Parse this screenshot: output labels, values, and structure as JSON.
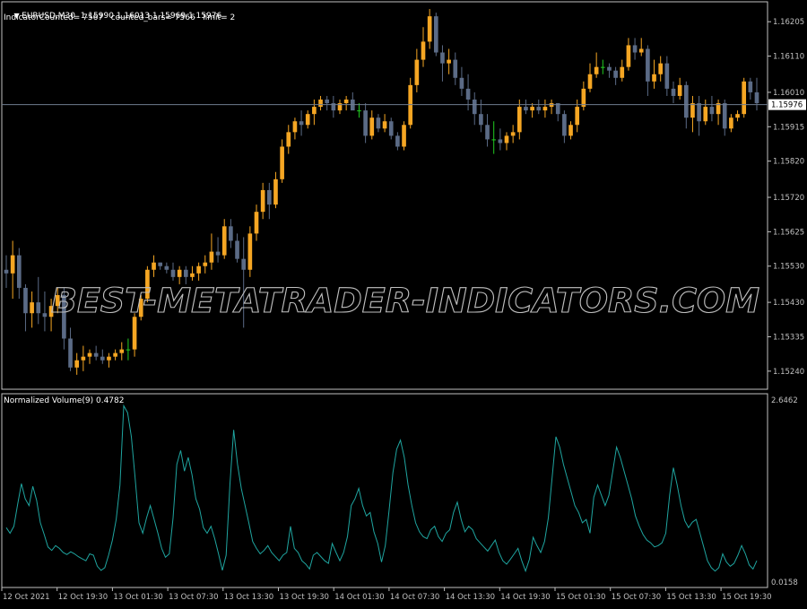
{
  "header": {
    "symbol_line": "EURUSD,M30  1.15990 1.16013 1.15969 1.15976",
    "counter_line": "IndicatorCounted= 7567   counted_bars= 7566   limit= 2"
  },
  "indicator": {
    "label": "Normalized Volume(9) 0.4782",
    "max_label": "2.6462",
    "min_label": "0.0158"
  },
  "watermark": "BEST-METATRADER-INDICATORS.COM",
  "colors": {
    "background": "#000000",
    "bull": "#f5a623",
    "bear": "#5b6b86",
    "doji": "#22cc22",
    "axis": "#c0c0c0",
    "price_line": "#6e7b8f",
    "volume": "#1fa5a0",
    "current_price_box": "#ffffff"
  },
  "chart_data": [
    {
      "type": "candlestick",
      "title": "EURUSD,M30",
      "current_price": 1.15976,
      "ylim": [
        1.1519,
        1.1626
      ],
      "y_ticks": [
        "1.16205",
        "1.16110",
        "1.16010",
        "1.15915",
        "1.15820",
        "1.15720",
        "1.15625",
        "1.15530",
        "1.15430",
        "1.15335",
        "1.15240"
      ],
      "x_ticks": [
        "12 Oct 2021",
        "12 Oct 19:30",
        "13 Oct 01:30",
        "13 Oct 07:30",
        "13 Oct 13:30",
        "13 Oct 19:30",
        "14 Oct 01:30",
        "14 Oct 07:30",
        "14 Oct 13:30",
        "14 Oct 19:30",
        "15 Oct 01:30",
        "15 Oct 07:30",
        "15 Oct 13:30",
        "15 Oct 19:30"
      ],
      "candles_ohlc": [
        [
          1.1552,
          1.1556,
          1.1547,
          1.1551
        ],
        [
          1.1551,
          1.156,
          1.1544,
          1.1556
        ],
        [
          1.1556,
          1.1558,
          1.1544,
          1.1547
        ],
        [
          1.1547,
          1.1548,
          1.1535,
          1.154
        ],
        [
          1.154,
          1.1546,
          1.1536,
          1.1543
        ],
        [
          1.1543,
          1.155,
          1.1537,
          1.154
        ],
        [
          1.154,
          1.1546,
          1.1535,
          1.1539
        ],
        [
          1.1539,
          1.1544,
          1.1535,
          1.1542
        ],
        [
          1.1542,
          1.1547,
          1.154,
          1.1545
        ],
        [
          1.1545,
          1.1547,
          1.153,
          1.1533
        ],
        [
          1.1533,
          1.1536,
          1.1524,
          1.1525
        ],
        [
          1.1525,
          1.1529,
          1.1523,
          1.1527
        ],
        [
          1.1527,
          1.1531,
          1.1524,
          1.1528
        ],
        [
          1.1528,
          1.153,
          1.1526,
          1.1529
        ],
        [
          1.1529,
          1.1531,
          1.1527,
          1.1528
        ],
        [
          1.1528,
          1.153,
          1.1526,
          1.1527
        ],
        [
          1.1527,
          1.1529,
          1.1525,
          1.1528
        ],
        [
          1.1528,
          1.153,
          1.1527,
          1.1529
        ],
        [
          1.1529,
          1.1532,
          1.1527,
          1.153
        ],
        [
          1.153,
          1.1533,
          1.1527,
          1.153
        ],
        [
          1.153,
          1.154,
          1.1528,
          1.1539
        ],
        [
          1.1539,
          1.1545,
          1.1538,
          1.1544
        ],
        [
          1.1544,
          1.1553,
          1.1543,
          1.1552
        ],
        [
          1.1552,
          1.1556,
          1.155,
          1.1554
        ],
        [
          1.1554,
          1.1554,
          1.1552,
          1.1553
        ],
        [
          1.1553,
          1.1554,
          1.1551,
          1.1552
        ],
        [
          1.1552,
          1.1554,
          1.1549,
          1.155
        ],
        [
          1.155,
          1.1553,
          1.1548,
          1.1552
        ],
        [
          1.1552,
          1.1553,
          1.1548,
          1.155
        ],
        [
          1.155,
          1.1553,
          1.1549,
          1.1551
        ],
        [
          1.1551,
          1.1554,
          1.1549,
          1.1553
        ],
        [
          1.1553,
          1.1556,
          1.1551,
          1.1554
        ],
        [
          1.1554,
          1.1562,
          1.1552,
          1.1557
        ],
        [
          1.1557,
          1.1561,
          1.1554,
          1.1556
        ],
        [
          1.1556,
          1.1566,
          1.1555,
          1.1564
        ],
        [
          1.1564,
          1.1566,
          1.1558,
          1.156
        ],
        [
          1.156,
          1.1562,
          1.1554,
          1.1555
        ],
        [
          1.1555,
          1.1561,
          1.1536,
          1.1552
        ],
        [
          1.1552,
          1.1564,
          1.155,
          1.1562
        ],
        [
          1.1562,
          1.157,
          1.156,
          1.1568
        ],
        [
          1.1568,
          1.1576,
          1.1566,
          1.1574
        ],
        [
          1.1574,
          1.1576,
          1.1566,
          1.157
        ],
        [
          1.157,
          1.1579,
          1.1569,
          1.1577
        ],
        [
          1.1577,
          1.1588,
          1.1576,
          1.1586
        ],
        [
          1.1586,
          1.1592,
          1.1584,
          1.159
        ],
        [
          1.159,
          1.1594,
          1.1588,
          1.1593
        ],
        [
          1.1593,
          1.1596,
          1.1589,
          1.1592
        ],
        [
          1.1592,
          1.1596,
          1.1591,
          1.1595
        ],
        [
          1.1595,
          1.1599,
          1.1592,
          1.1597
        ],
        [
          1.1597,
          1.16,
          1.1596,
          1.1599
        ],
        [
          1.1599,
          1.16,
          1.1596,
          1.1598
        ],
        [
          1.1598,
          1.16,
          1.1594,
          1.1596
        ],
        [
          1.1596,
          1.1599,
          1.1595,
          1.1598
        ],
        [
          1.1598,
          1.16,
          1.1596,
          1.1599
        ],
        [
          1.1599,
          1.1601,
          1.1597,
          1.1596
        ],
        [
          1.1596,
          1.1598,
          1.1594,
          1.1596
        ],
        [
          1.1596,
          1.1598,
          1.1587,
          1.1589
        ],
        [
          1.1589,
          1.1596,
          1.1588,
          1.1594
        ],
        [
          1.1594,
          1.1595,
          1.159,
          1.1591
        ],
        [
          1.1591,
          1.1595,
          1.159,
          1.1593
        ],
        [
          1.1593,
          1.1594,
          1.1588,
          1.1589
        ],
        [
          1.1589,
          1.159,
          1.1585,
          1.1586
        ],
        [
          1.1586,
          1.1593,
          1.1585,
          1.1592
        ],
        [
          1.1592,
          1.1605,
          1.1591,
          1.1603
        ],
        [
          1.1603,
          1.1613,
          1.1601,
          1.161
        ],
        [
          1.161,
          1.1619,
          1.1608,
          1.1615
        ],
        [
          1.1615,
          1.1624,
          1.1613,
          1.1622
        ],
        [
          1.1622,
          1.1623,
          1.1611,
          1.1612
        ],
        [
          1.1612,
          1.1614,
          1.1604,
          1.1609
        ],
        [
          1.1609,
          1.1613,
          1.1606,
          1.161
        ],
        [
          1.161,
          1.1612,
          1.1603,
          1.1605
        ],
        [
          1.1605,
          1.1608,
          1.16,
          1.1602
        ],
        [
          1.1602,
          1.1606,
          1.1596,
          1.1599
        ],
        [
          1.1599,
          1.1601,
          1.1592,
          1.1595
        ],
        [
          1.1595,
          1.1599,
          1.159,
          1.1592
        ],
        [
          1.1592,
          1.1595,
          1.1586,
          1.1588
        ],
        [
          1.1588,
          1.1593,
          1.1584,
          1.1588
        ],
        [
          1.1588,
          1.1591,
          1.1585,
          1.1587
        ],
        [
          1.1587,
          1.159,
          1.1585,
          1.1589
        ],
        [
          1.1589,
          1.1592,
          1.1587,
          1.159
        ],
        [
          1.159,
          1.1599,
          1.1588,
          1.1597
        ],
        [
          1.1597,
          1.1599,
          1.1595,
          1.1596
        ],
        [
          1.1596,
          1.1598,
          1.1594,
          1.1597
        ],
        [
          1.1597,
          1.1599,
          1.1595,
          1.1596
        ],
        [
          1.1596,
          1.1599,
          1.1594,
          1.1597
        ],
        [
          1.1597,
          1.1599,
          1.1595,
          1.1598
        ],
        [
          1.1598,
          1.1598,
          1.1593,
          1.1595
        ],
        [
          1.1595,
          1.1596,
          1.1587,
          1.1589
        ],
        [
          1.1589,
          1.1593,
          1.1588,
          1.1592
        ],
        [
          1.1592,
          1.1599,
          1.159,
          1.1597
        ],
        [
          1.1597,
          1.1604,
          1.1596,
          1.1602
        ],
        [
          1.1602,
          1.1609,
          1.1601,
          1.1606
        ],
        [
          1.1606,
          1.1612,
          1.1605,
          1.1608
        ],
        [
          1.1608,
          1.161,
          1.1606,
          1.1608
        ],
        [
          1.1608,
          1.1609,
          1.1605,
          1.1607
        ],
        [
          1.1607,
          1.1608,
          1.1603,
          1.1605
        ],
        [
          1.1605,
          1.161,
          1.1604,
          1.1608
        ],
        [
          1.1608,
          1.1616,
          1.1607,
          1.1614
        ],
        [
          1.1614,
          1.1616,
          1.161,
          1.1612
        ],
        [
          1.1612,
          1.1616,
          1.1611,
          1.1613
        ],
        [
          1.1613,
          1.1614,
          1.16,
          1.1604
        ],
        [
          1.1604,
          1.161,
          1.1602,
          1.1606
        ],
        [
          1.1606,
          1.1611,
          1.1604,
          1.1609
        ],
        [
          1.1609,
          1.1611,
          1.16,
          1.1602
        ],
        [
          1.1602,
          1.1604,
          1.1598,
          1.16
        ],
        [
          1.16,
          1.1605,
          1.1599,
          1.1603
        ],
        [
          1.1603,
          1.1604,
          1.1591,
          1.1594
        ],
        [
          1.1594,
          1.16,
          1.159,
          1.1598
        ],
        [
          1.1598,
          1.16,
          1.1589,
          1.1593
        ],
        [
          1.1593,
          1.1599,
          1.1592,
          1.1597
        ],
        [
          1.1597,
          1.16,
          1.1593,
          1.1595
        ],
        [
          1.1595,
          1.1599,
          1.1592,
          1.1598
        ],
        [
          1.1598,
          1.1599,
          1.1589,
          1.1591
        ],
        [
          1.1591,
          1.1595,
          1.159,
          1.1594
        ],
        [
          1.1594,
          1.1596,
          1.1593,
          1.1595
        ],
        [
          1.1595,
          1.1605,
          1.1594,
          1.1604
        ],
        [
          1.1604,
          1.1605,
          1.1599,
          1.1601
        ],
        [
          1.1601,
          1.1605,
          1.1596,
          1.1598
        ]
      ]
    },
    {
      "type": "line",
      "title": "Normalized Volume(9) 0.4782",
      "ylim": [
        0.0158,
        2.6462
      ],
      "series": [
        {
          "name": "Normalized Volume(9)",
          "values": [
            0.78,
            0.7,
            0.8,
            1.12,
            1.42,
            1.2,
            1.1,
            1.38,
            1.18,
            0.85,
            0.68,
            0.5,
            0.45,
            0.52,
            0.48,
            0.42,
            0.39,
            0.43,
            0.4,
            0.36,
            0.33,
            0.3,
            0.4,
            0.38,
            0.22,
            0.16,
            0.2,
            0.38,
            0.6,
            0.9,
            1.4,
            2.55,
            2.45,
            2.1,
            1.5,
            0.85,
            0.7,
            0.92,
            1.1,
            0.9,
            0.7,
            0.48,
            0.35,
            0.4,
            0.92,
            1.7,
            1.9,
            1.6,
            1.8,
            1.55,
            1.2,
            1.05,
            0.78,
            0.7,
            0.8,
            0.62,
            0.4,
            0.16,
            0.38,
            1.4,
            2.2,
            1.7,
            1.35,
            1.1,
            0.85,
            0.58,
            0.48,
            0.4,
            0.45,
            0.52,
            0.42,
            0.36,
            0.3,
            0.38,
            0.42,
            0.8,
            0.48,
            0.42,
            0.3,
            0.25,
            0.18,
            0.38,
            0.42,
            0.36,
            0.3,
            0.26,
            0.55,
            0.42,
            0.3,
            0.42,
            0.65,
            1.1,
            1.2,
            1.35,
            1.1,
            0.95,
            1.0,
            0.72,
            0.55,
            0.28,
            0.52,
            1.04,
            1.58,
            1.92,
            2.05,
            1.8,
            1.4,
            1.1,
            0.85,
            0.72,
            0.65,
            0.62,
            0.75,
            0.8,
            0.65,
            0.58,
            0.7,
            0.75,
            1.0,
            1.15,
            0.9,
            0.72,
            0.8,
            0.75,
            0.62,
            0.56,
            0.5,
            0.44,
            0.52,
            0.6,
            0.42,
            0.3,
            0.25,
            0.32,
            0.4,
            0.48,
            0.3,
            0.15,
            0.32,
            0.64,
            0.52,
            0.42,
            0.58,
            0.92,
            1.5,
            2.1,
            1.95,
            1.7,
            1.5,
            1.3,
            1.1,
            1.0,
            0.85,
            0.9,
            0.7,
            1.22,
            1.4,
            1.25,
            1.1,
            1.25,
            1.6,
            1.95,
            1.8,
            1.6,
            1.4,
            1.2,
            0.95,
            0.8,
            0.68,
            0.6,
            0.56,
            0.5,
            0.52,
            0.56,
            0.7,
            1.25,
            1.65,
            1.4,
            1.1,
            0.88,
            0.78,
            0.86,
            0.9,
            0.7,
            0.5,
            0.3,
            0.2,
            0.15,
            0.2,
            0.4,
            0.28,
            0.22,
            0.26,
            0.38,
            0.52,
            0.4,
            0.24,
            0.18,
            0.3
          ]
        }
      ]
    }
  ]
}
